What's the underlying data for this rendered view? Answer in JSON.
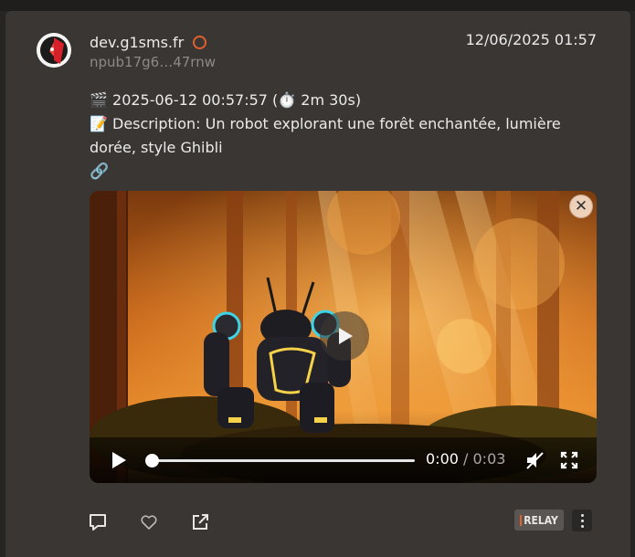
{
  "post": {
    "author_name": "dev.g1sms.fr",
    "author_npub": "npub17g6…47rnw",
    "timestamp": "12/06/2025 01:57",
    "content": {
      "line1_emoji": "🎬",
      "line1_text": " 2025-06-12 00:57:57 (",
      "line1_timer_emoji": "⏱️",
      "line1_tail": " 2m 30s)",
      "line2_emoji": "📝",
      "line2_text": " Description: Un robot explorant une forêt enchantée, lumière dorée, style Ghibli",
      "link_emoji": "🔗"
    }
  },
  "video": {
    "current_time": "0:00",
    "separator": " / ",
    "duration": "0:03",
    "progress": 0.0
  },
  "icons": {
    "avatar": "nostr-avatar-logo",
    "status": "status-ring-icon",
    "close": "close-icon",
    "play": "play-icon",
    "mute": "mute-icon",
    "fullscreen": "fullscreen-icon",
    "reply": "reply-icon",
    "like": "heart-icon",
    "share": "share-icon",
    "more": "more-vertical-icon"
  },
  "relay_badge": {
    "label": "RELAY"
  },
  "colors": {
    "background": "#262524",
    "card": "#393634",
    "accent": "#e0612b",
    "link": "#5aa6e6",
    "muted_text": "#8d8987"
  }
}
